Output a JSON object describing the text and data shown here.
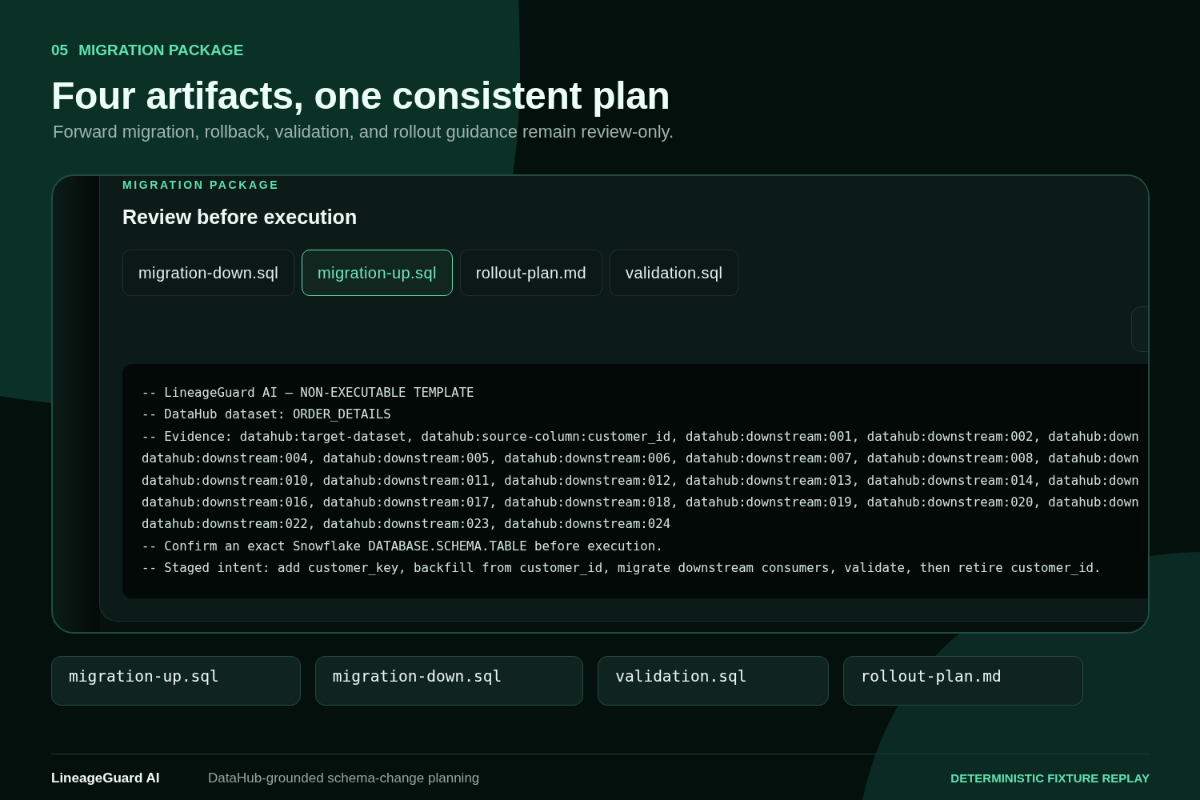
{
  "eyebrow": {
    "number": "05",
    "label": "MIGRATION PACKAGE"
  },
  "title": "Four artifacts, one consistent plan",
  "subtitle": "Forward migration, rollback, validation, and rollout guidance remain review-only.",
  "package_panel": {
    "eyebrow": "MIGRATION PACKAGE",
    "heading": "Review before execution",
    "tabs": [
      {
        "label": "migration-down.sql",
        "selected": false
      },
      {
        "label": "migration-up.sql",
        "selected": true
      },
      {
        "label": "rollout-plan.md",
        "selected": false
      },
      {
        "label": "validation.sql",
        "selected": false
      }
    ],
    "code_lines": [
      "-- LineageGuard AI — NON-EXECUTABLE TEMPLATE",
      "-- DataHub dataset: ORDER_DETAILS",
      "-- Evidence: datahub:target-dataset, datahub:source-column:customer_id, datahub:downstream:001, datahub:downstream:002, datahub:down",
      "datahub:downstream:004, datahub:downstream:005, datahub:downstream:006, datahub:downstream:007, datahub:downstream:008, datahub:down",
      "datahub:downstream:010, datahub:downstream:011, datahub:downstream:012, datahub:downstream:013, datahub:downstream:014, datahub:down",
      "datahub:downstream:016, datahub:downstream:017, datahub:downstream:018, datahub:downstream:019, datahub:downstream:020, datahub:down",
      "datahub:downstream:022, datahub:downstream:023, datahub:downstream:024",
      "-- Confirm an exact Snowflake DATABASE.SCHEMA.TABLE before execution.",
      "-- Staged intent: add customer_key, backfill from customer_id, migrate downstream consumers, validate, then retire customer_id."
    ]
  },
  "artifacts": [
    "migration-up.sql",
    "migration-down.sql",
    "validation.sql",
    "rollout-plan.md"
  ],
  "footer": {
    "brand": "LineageGuard AI",
    "tagline": "DataHub-grounded schema-change planning",
    "status": "DETERMINISTIC FIXTURE REPLAY"
  }
}
